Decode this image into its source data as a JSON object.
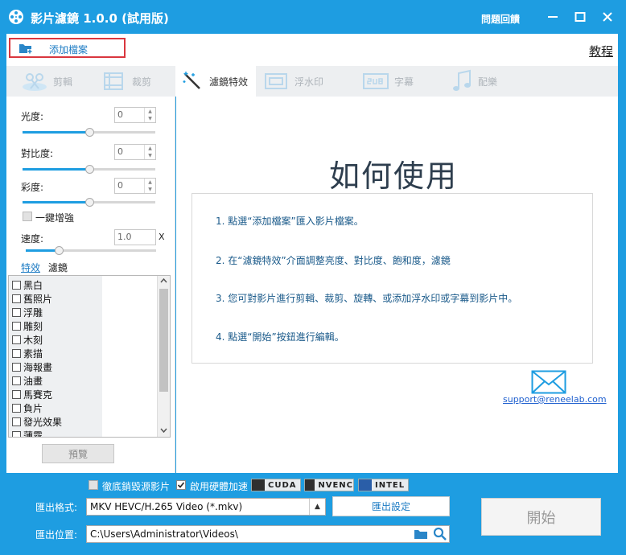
{
  "app": {
    "title": "影片濾鏡 1.0.0 (試用版)",
    "feedback": "問題回饋",
    "tutorial": "教程"
  },
  "toolbar": {
    "add_file": "添加檔案"
  },
  "tabs": [
    {
      "label": "剪輯",
      "icon": "clip-icon"
    },
    {
      "label": "裁剪",
      "icon": "crop-icon"
    },
    {
      "label": "濾鏡特效",
      "icon": "magic-wand-icon",
      "active": true
    },
    {
      "label": "浮水印",
      "icon": "watermark-icon"
    },
    {
      "label": "字幕",
      "icon": "subtitle-icon"
    },
    {
      "label": "配樂",
      "icon": "music-icon"
    }
  ],
  "adjust": {
    "brightness": {
      "label": "光度:",
      "value": "0",
      "level": 0.5
    },
    "contrast": {
      "label": "對比度:",
      "value": "0",
      "level": 0.5
    },
    "saturation": {
      "label": "彩度:",
      "value": "0",
      "level": 0.5
    },
    "enhance": "一鍵增強",
    "speed": {
      "label": "速度:",
      "value": "1.0",
      "unit": "X",
      "level": 0.25
    }
  },
  "subtabs": {
    "effect": "特效",
    "filter": "濾鏡"
  },
  "effects": [
    "黑白",
    "舊照片",
    "浮雕",
    "雕刻",
    "木刻",
    "素描",
    "海報畫",
    "油畫",
    "馬賽克",
    "負片",
    "發光效果",
    "薄霧"
  ],
  "preview_button": "預覽",
  "howto": {
    "title": "如何使用",
    "steps": [
      "1. 點選“添加檔案”匯入影片檔案。",
      "2. 在“濾鏡特效”介面調整亮度、對比度、飽和度，濾鏡",
      "3. 您可對影片進行剪輯、裁剪、旋轉、或添加浮水印或字幕到影片中。",
      "4. 點選“開始”按鈕進行編輯。"
    ],
    "support": "support@reneelab.com"
  },
  "bottom": {
    "opt_remove_source": "徹底銷毀源影片",
    "opt_hw_accel": "啟用硬體加速",
    "hw_tags": [
      "CUDA",
      "NVENC",
      "INTEL"
    ],
    "format_label": "匯出格式:",
    "format_value": "MKV HEVC/H.265 Video (*.mkv)",
    "settings_button": "匯出設定",
    "path_label": "匯出位置:",
    "path_value": "C:\\Users\\Administrator\\Videos\\",
    "start_button": "開始"
  }
}
